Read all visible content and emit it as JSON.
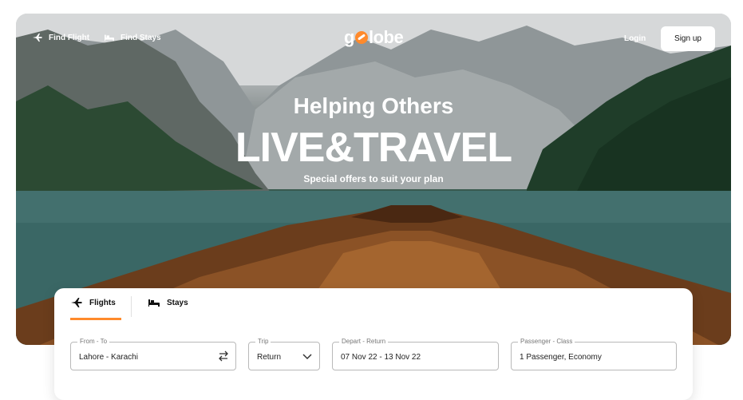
{
  "nav": {
    "find_flight": "Find Flight",
    "find_stays": "Find Stays",
    "logo_before": "g",
    "logo_after": "lobe",
    "login": "Login",
    "signup": "Sign up"
  },
  "hero": {
    "line1": "Helping Others",
    "line2": "LIVE&TRAVEL",
    "line3": "Special offers to suit your plan"
  },
  "search": {
    "tabs": [
      {
        "label": "Flights",
        "icon": "airplane-icon",
        "active": true
      },
      {
        "label": "Stays",
        "icon": "bed-icon",
        "active": false
      }
    ],
    "fields": [
      {
        "label": "From - To",
        "value": "Lahore - Karachi",
        "icon": "swap-icon"
      },
      {
        "label": "Trip",
        "value": "Return",
        "icon": "chevron-down-icon"
      },
      {
        "label": "Depart - Return",
        "value": "07 Nov 22 - 13 Nov 22"
      },
      {
        "label": "Passenger - Class",
        "value": "1 Passenger, Economy"
      }
    ]
  },
  "colors": {
    "accent": "#ff8a2c",
    "text": "#111111",
    "border": "#b9b9b9"
  }
}
